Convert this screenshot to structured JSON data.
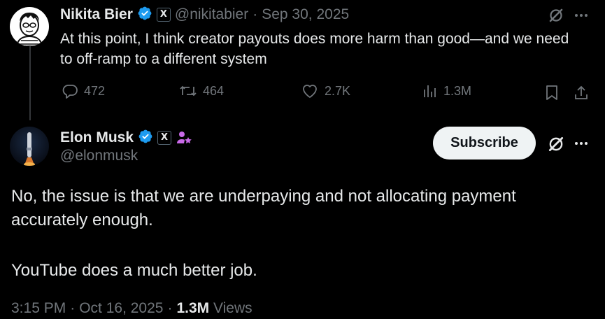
{
  "parent_post": {
    "author_name": "Nikita Bier",
    "author_badge": "X",
    "handle": "@nikitabier",
    "separator": "·",
    "date": "Sep 30, 2025",
    "text": "At this point, I think creator payouts does more harm than good—and we need to off-ramp to a different system",
    "actions": {
      "replies": "472",
      "reposts": "464",
      "likes": "2.7K",
      "views": "1.3M"
    }
  },
  "main_post": {
    "author_name": "Elon Musk",
    "author_badge": "X",
    "handle": "@elonmusk",
    "subscribe_label": "Subscribe",
    "text_line1": "No, the issue is that we are underpaying and not allocating payment accurately enough.",
    "text_line2": "YouTube does a much better job.",
    "time": "3:15 PM",
    "separator": "·",
    "date": "Oct 16, 2025",
    "views_count": "1.3M",
    "views_label": "Views"
  },
  "colors": {
    "background": "#000000",
    "text": "#e7e9ea",
    "muted": "#71767b",
    "verified": "#1d9bf0",
    "subscriber_icon": "#c96ae8"
  },
  "icons": [
    "verified-badge-icon",
    "x-affiliate-icon",
    "grok-icon",
    "more-icon",
    "reply-icon",
    "repost-icon",
    "like-icon",
    "views-icon",
    "bookmark-icon",
    "share-icon",
    "subscriber-icon"
  ]
}
